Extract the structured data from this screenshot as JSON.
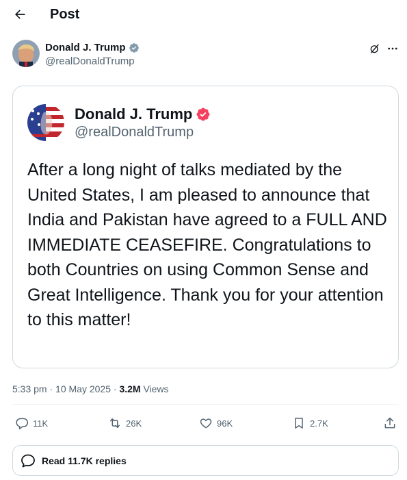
{
  "header": {
    "title": "Post"
  },
  "author": {
    "name": "Donald J. Trump",
    "handle": "@realDonaldTrump"
  },
  "quoted": {
    "name": "Donald J. Trump",
    "handle": "@realDonaldTrump",
    "text": "After a long night of talks mediated by the United States, I am pleased to announce that India and Pakistan have agreed to a FULL AND IMMEDIATE CEASEFIRE. Congratulations to both Countries on using Common Sense and Great Intelligence. Thank you for your attention to this matter!",
    "verified_color": "#f4415f"
  },
  "meta": {
    "time": "5:33 pm",
    "date": "10 May 2025",
    "views_count": "3.2M",
    "views_label": "Views"
  },
  "actions": {
    "replies": "11K",
    "reposts": "26K",
    "likes": "96K",
    "bookmarks": "2.7K"
  },
  "read_replies": "Read 11.7K replies",
  "colors": {
    "verified": "#829aab",
    "text": "#0f1419",
    "secondary": "#536471",
    "border": "#cfd9de"
  },
  "icons": [
    "back-arrow-icon",
    "verified-badge-icon",
    "grok-icon",
    "more-icon",
    "reply-icon",
    "repost-icon",
    "like-icon",
    "bookmark-icon",
    "share-icon",
    "chat-bubble-icon"
  ]
}
